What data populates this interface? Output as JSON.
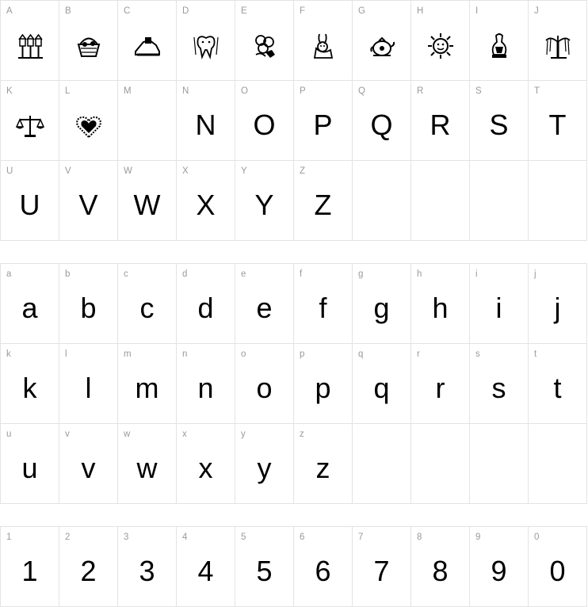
{
  "uppercase": [
    {
      "key": "A",
      "glyph": "",
      "icon": "birdhouses-icon"
    },
    {
      "key": "B",
      "glyph": "",
      "icon": "basket-icon"
    },
    {
      "key": "C",
      "glyph": "",
      "icon": "hand-icon"
    },
    {
      "key": "D",
      "glyph": "",
      "icon": "tooth-icon"
    },
    {
      "key": "E",
      "glyph": "",
      "icon": "flower-icon"
    },
    {
      "key": "F",
      "glyph": "",
      "icon": "bunny-icon"
    },
    {
      "key": "G",
      "glyph": "",
      "icon": "teapot-icon"
    },
    {
      "key": "H",
      "glyph": "",
      "icon": "sun-face-icon"
    },
    {
      "key": "I",
      "glyph": "",
      "icon": "vase-icon"
    },
    {
      "key": "J",
      "glyph": "",
      "icon": "willow-tree-icon"
    },
    {
      "key": "K",
      "glyph": "",
      "icon": "scales-icon"
    },
    {
      "key": "L",
      "glyph": "",
      "icon": "heart-icon"
    },
    {
      "key": "M",
      "glyph": "",
      "icon": ""
    },
    {
      "key": "N",
      "glyph": "N",
      "icon": ""
    },
    {
      "key": "O",
      "glyph": "O",
      "icon": ""
    },
    {
      "key": "P",
      "glyph": "P",
      "icon": ""
    },
    {
      "key": "Q",
      "glyph": "Q",
      "icon": ""
    },
    {
      "key": "R",
      "glyph": "R",
      "icon": ""
    },
    {
      "key": "S",
      "glyph": "S",
      "icon": ""
    },
    {
      "key": "T",
      "glyph": "T",
      "icon": ""
    },
    {
      "key": "U",
      "glyph": "U",
      "icon": ""
    },
    {
      "key": "V",
      "glyph": "V",
      "icon": ""
    },
    {
      "key": "W",
      "glyph": "W",
      "icon": ""
    },
    {
      "key": "X",
      "glyph": "X",
      "icon": ""
    },
    {
      "key": "Y",
      "glyph": "Y",
      "icon": ""
    },
    {
      "key": "Z",
      "glyph": "Z",
      "icon": ""
    }
  ],
  "lowercase": [
    {
      "key": "a",
      "glyph": "a"
    },
    {
      "key": "b",
      "glyph": "b"
    },
    {
      "key": "c",
      "glyph": "c"
    },
    {
      "key": "d",
      "glyph": "d"
    },
    {
      "key": "e",
      "glyph": "e"
    },
    {
      "key": "f",
      "glyph": "f"
    },
    {
      "key": "g",
      "glyph": "g"
    },
    {
      "key": "h",
      "glyph": "h"
    },
    {
      "key": "i",
      "glyph": "i"
    },
    {
      "key": "j",
      "glyph": "j"
    },
    {
      "key": "k",
      "glyph": "k"
    },
    {
      "key": "l",
      "glyph": "l"
    },
    {
      "key": "m",
      "glyph": "m"
    },
    {
      "key": "n",
      "glyph": "n"
    },
    {
      "key": "o",
      "glyph": "o"
    },
    {
      "key": "p",
      "glyph": "p"
    },
    {
      "key": "q",
      "glyph": "q"
    },
    {
      "key": "r",
      "glyph": "r"
    },
    {
      "key": "s",
      "glyph": "s"
    },
    {
      "key": "t",
      "glyph": "t"
    },
    {
      "key": "u",
      "glyph": "u"
    },
    {
      "key": "v",
      "glyph": "v"
    },
    {
      "key": "w",
      "glyph": "w"
    },
    {
      "key": "x",
      "glyph": "x"
    },
    {
      "key": "y",
      "glyph": "y"
    },
    {
      "key": "z",
      "glyph": "z"
    }
  ],
  "digits": [
    {
      "key": "1",
      "glyph": "1"
    },
    {
      "key": "2",
      "glyph": "2"
    },
    {
      "key": "3",
      "glyph": "3"
    },
    {
      "key": "4",
      "glyph": "4"
    },
    {
      "key": "5",
      "glyph": "5"
    },
    {
      "key": "6",
      "glyph": "6"
    },
    {
      "key": "7",
      "glyph": "7"
    },
    {
      "key": "8",
      "glyph": "8"
    },
    {
      "key": "9",
      "glyph": "9"
    },
    {
      "key": "0",
      "glyph": "0"
    }
  ],
  "colors": {
    "grid_line": "#e3e3e3",
    "key_label": "#9a9a9a",
    "glyph": "#000000"
  }
}
